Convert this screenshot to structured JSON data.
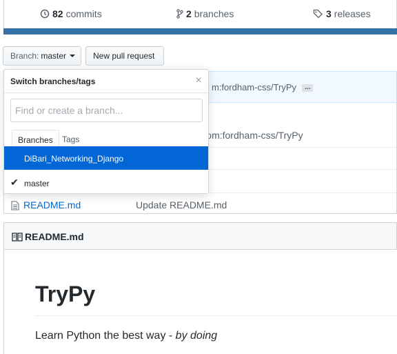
{
  "stats": {
    "commits_count": "82",
    "commits_label": "commits",
    "branches_count": "2",
    "branches_label": "branches",
    "releases_count": "3",
    "releases_label": "releases"
  },
  "toolbar": {
    "branch_prefix": "Branch:",
    "branch_name": "master",
    "new_pr_label": "New pull request"
  },
  "commit_bar": {
    "text": "m:fordham-css/TryPy",
    "ellipsis": "..."
  },
  "files": [
    {
      "name": "",
      "message": "aster' of github.com:fordham-css/TryPy"
    },
    {
      "name": "",
      "message": ""
    },
    {
      "name": "",
      "message": ""
    },
    {
      "name": "README.md",
      "message": "Update README.md"
    }
  ],
  "readme": {
    "header_title": "README.md",
    "heading": "TryPy",
    "paragraph_plain": "Learn Python the best way - ",
    "paragraph_em": "by doing"
  },
  "branch_dropdown": {
    "title": "Switch branches/tags",
    "close_glyph": "×",
    "filter_placeholder": "Find or create a branch...",
    "tab_branches": "Branches",
    "tab_tags": "Tags",
    "items": [
      {
        "label": "DiBari_Networking_Django",
        "selected_highlight": true
      },
      {
        "label": "master",
        "checked": true,
        "check_glyph": "✔"
      }
    ]
  },
  "colors": {
    "link": "#0366d6",
    "language_bar": "#3572a5",
    "highlight": "#0366d6"
  }
}
